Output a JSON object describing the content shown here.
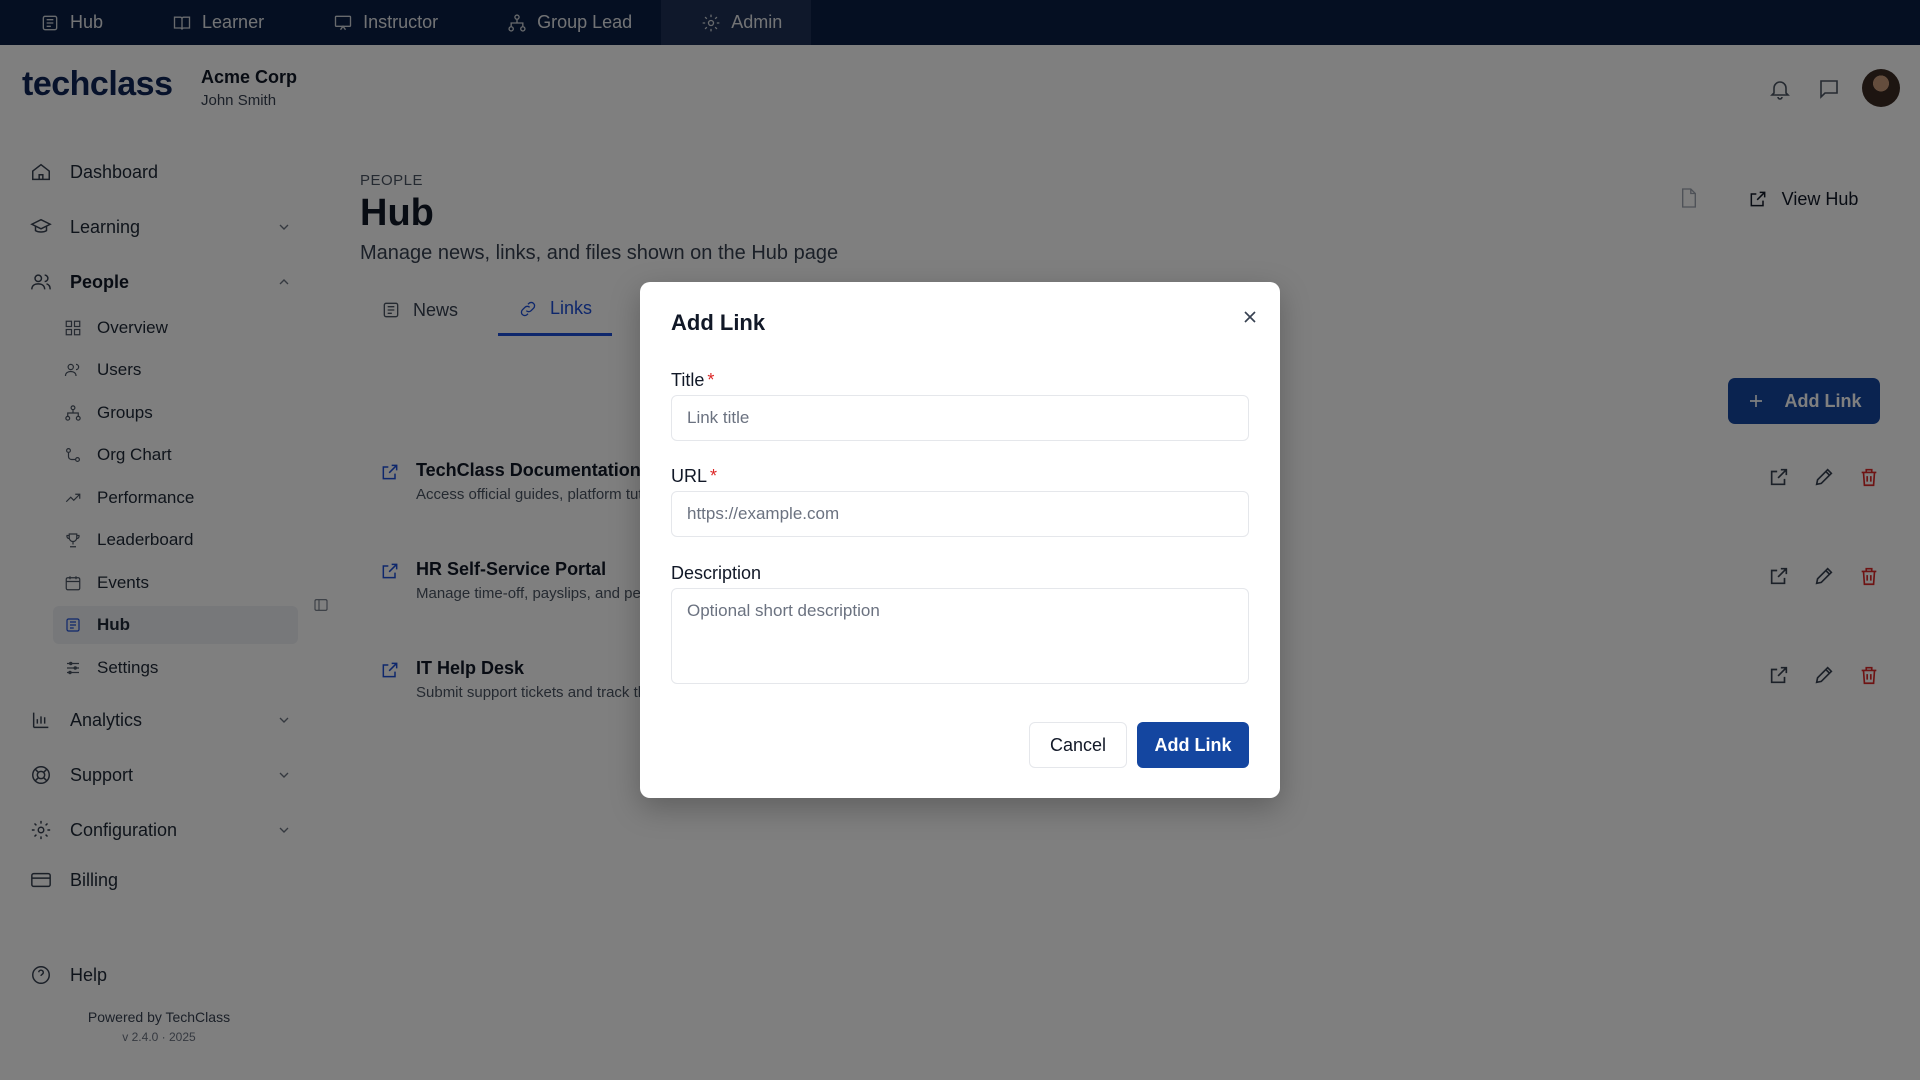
{
  "role_tabs": [
    {
      "label": "Hub",
      "icon": "newspaper-icon"
    },
    {
      "label": "Learner",
      "icon": "book-icon"
    },
    {
      "label": "Instructor",
      "icon": "presentation-icon"
    },
    {
      "label": "Group Lead",
      "icon": "org-icon"
    },
    {
      "label": "Admin",
      "icon": "gear-icon",
      "active": true
    }
  ],
  "header": {
    "logo_main": "techclass",
    "org_name": "Acme Corp",
    "user_name": "John Smith"
  },
  "sidebar": {
    "items": {
      "dashboard": "Dashboard",
      "learning": "Learning",
      "people": "People",
      "analytics": "Analytics",
      "support": "Support",
      "configuration": "Configuration",
      "billing": "Billing",
      "help": "Help"
    },
    "people_sub": [
      {
        "label": "Overview",
        "icon": "grid-icon"
      },
      {
        "label": "Users",
        "icon": "users-icon"
      },
      {
        "label": "Groups",
        "icon": "org-icon"
      },
      {
        "label": "Org Chart",
        "icon": "org-chart-icon"
      },
      {
        "label": "Performance",
        "icon": "trend-icon"
      },
      {
        "label": "Leaderboard",
        "icon": "trophy-icon"
      },
      {
        "label": "Events",
        "icon": "calendar-icon"
      },
      {
        "label": "Hub",
        "icon": "newspaper-icon",
        "active": true
      },
      {
        "label": "Settings",
        "icon": "sliders-icon"
      }
    ],
    "powered_by": "Powered by TechClass",
    "version": "v 2.4.0 · 2025"
  },
  "main": {
    "breadcrumb": "PEOPLE",
    "title": "Hub",
    "subtitle": "Manage news, links, and files shown on the Hub page",
    "view_hub_label": "View Hub",
    "tabs": [
      {
        "label": "News",
        "icon": "newspaper-icon"
      },
      {
        "label": "Links",
        "icon": "link-icon",
        "active": true
      }
    ],
    "add_link_label": "Add Link",
    "links": [
      {
        "title": "TechClass Documentation",
        "description": "Access official guides, platform tutorials and product documentation"
      },
      {
        "title": "HR Self-Service Portal",
        "description": "Manage time-off, payslips, and personal information"
      },
      {
        "title": "IT Help Desk",
        "description": "Submit support tickets and track their status"
      }
    ]
  },
  "modal": {
    "title": "Add Link",
    "title_label": "Title",
    "title_placeholder": "Link title",
    "url_label": "URL",
    "url_placeholder": "https://example.com",
    "description_label": "Description",
    "description_placeholder": "Optional short description",
    "cancel_label": "Cancel",
    "submit_label": "Add Link"
  },
  "colors": {
    "navbar": "#0b1f44",
    "primary": "#1446a0",
    "accent": "#1d4ed8",
    "danger": "#dc2626"
  }
}
